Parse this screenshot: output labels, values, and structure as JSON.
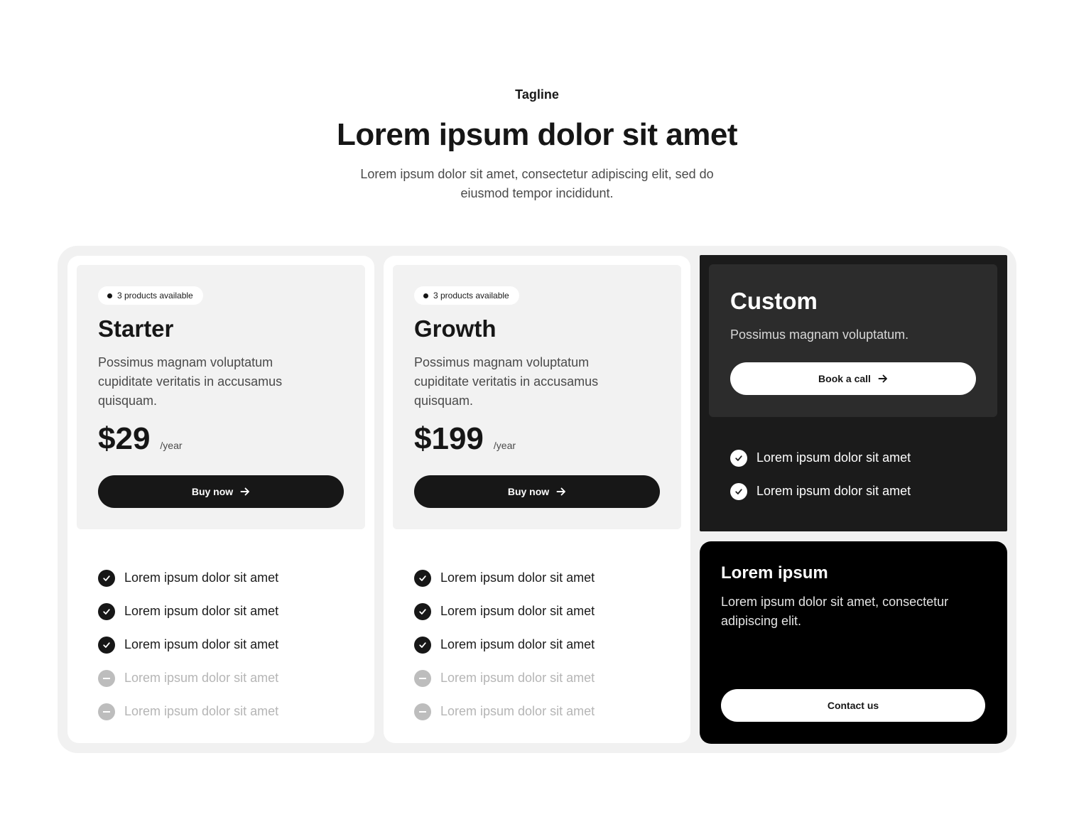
{
  "header": {
    "tagline": "Tagline",
    "title": "Lorem ipsum dolor sit amet",
    "subtitle": "Lorem ipsum dolor sit amet, consectetur adipiscing elit, sed do eiusmod tempor incididunt."
  },
  "plans": [
    {
      "badge": "3 products available",
      "name": "Starter",
      "description": "Possimus magnam voluptatum cupiditate veritatis in accusamus quisquam.",
      "price": "$29",
      "period": "/year",
      "button": "Buy now",
      "features": [
        {
          "label": "Lorem ipsum dolor sit amet",
          "included": true
        },
        {
          "label": "Lorem ipsum dolor sit amet",
          "included": true
        },
        {
          "label": "Lorem ipsum dolor sit amet",
          "included": true
        },
        {
          "label": "Lorem ipsum dolor sit amet",
          "included": false
        },
        {
          "label": "Lorem ipsum dolor sit amet",
          "included": false
        }
      ]
    },
    {
      "badge": "3 products available",
      "name": "Growth",
      "description": "Possimus magnam voluptatum cupiditate veritatis in accusamus quisquam.",
      "price": "$199",
      "period": "/year",
      "button": "Buy now",
      "features": [
        {
          "label": "Lorem ipsum dolor sit amet",
          "included": true
        },
        {
          "label": "Lorem ipsum dolor sit amet",
          "included": true
        },
        {
          "label": "Lorem ipsum dolor sit amet",
          "included": true
        },
        {
          "label": "Lorem ipsum dolor sit amet",
          "included": false
        },
        {
          "label": "Lorem ipsum dolor sit amet",
          "included": false
        }
      ]
    }
  ],
  "custom": {
    "name": "Custom",
    "description": "Possimus magnam voluptatum.",
    "button": "Book a call",
    "features": [
      {
        "label": "Lorem ipsum dolor sit amet",
        "included": true
      },
      {
        "label": "Lorem ipsum dolor sit amet",
        "included": true
      }
    ]
  },
  "contact": {
    "title": "Lorem ipsum",
    "description": "Lorem ipsum dolor sit amet, consectetur adipiscing elit.",
    "button": "Contact us"
  },
  "icons": {
    "check": "check-icon",
    "minus": "minus-icon",
    "arrow": "arrow-right-icon",
    "dot": "dot-icon"
  },
  "colors": {
    "primary": "#171717",
    "panel_bg": "#f1f1f1",
    "card_top_bg": "#f2f2f2",
    "custom_bg": "#1b1b1b",
    "custom_top_bg": "#2c2c2c",
    "contact_bg": "#000000",
    "muted_text": "#b5b5b5"
  }
}
